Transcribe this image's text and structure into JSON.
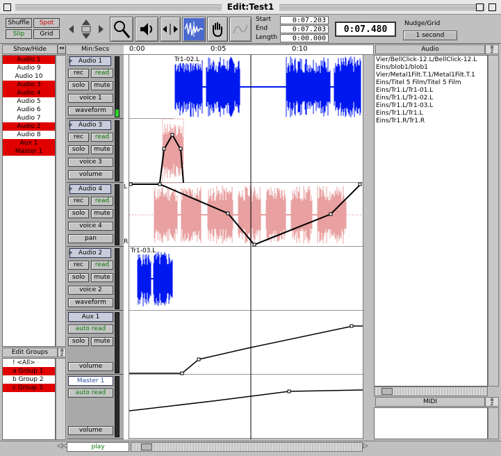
{
  "window": {
    "title": "Edit:Test1"
  },
  "modes": {
    "shuffle": "Shuffle",
    "spot": "Spot",
    "slip": "Slip",
    "grid": "Grid"
  },
  "tools": [
    "zoom-icon",
    "speaker-icon",
    "trim-icon",
    "selector-icon",
    "hand-icon",
    "pencil-icon"
  ],
  "counters": {
    "start_label": "Start",
    "start_value": "0:07.203",
    "end_label": "End",
    "end_value": "0:07.203",
    "length_label": "Length",
    "length_value": "0:00.000",
    "main_counter": "0:07.480"
  },
  "nudge": {
    "label": "Nudge/Grid",
    "value": "1 second"
  },
  "show_hide": {
    "header": "Show/Hide",
    "items": [
      {
        "label": "Audio 1",
        "selected": true
      },
      {
        "label": "Audio 9",
        "selected": false
      },
      {
        "label": "Audio 10",
        "selected": false
      },
      {
        "label": "Audio 3",
        "selected": true
      },
      {
        "label": "Audio 4",
        "selected": true
      },
      {
        "label": "Audio 5",
        "selected": false
      },
      {
        "label": "Audio 6",
        "selected": false
      },
      {
        "label": "Audio 7",
        "selected": false
      },
      {
        "label": "Audio 2",
        "selected": true
      },
      {
        "label": "Audio 8",
        "selected": false
      },
      {
        "label": "Aux 1",
        "selected": true
      },
      {
        "label": "Master 1",
        "selected": true
      }
    ]
  },
  "edit_groups": {
    "header": "Edit Groups",
    "items": [
      {
        "label": "! <All>",
        "selected": false
      },
      {
        "label": "a Group 1",
        "selected": true
      },
      {
        "label": "b Group 2",
        "selected": false
      },
      {
        "label": "c Group 3",
        "selected": true
      }
    ]
  },
  "ruler": {
    "header": "Min:Secs",
    "ticks": [
      "0:00",
      "0:05",
      "0:10"
    ]
  },
  "tracks": [
    {
      "name": "Audio 1",
      "rec": "rec",
      "read": "read",
      "solo": "solo",
      "mute": "mute",
      "voice": "voice 1",
      "view": "waveform",
      "region": "Tr1-02.L"
    },
    {
      "name": "Audio 3",
      "rec": "rec",
      "read": "read",
      "solo": "solo",
      "mute": "mute",
      "voice": "voice 3",
      "view": "volume",
      "region": ""
    },
    {
      "name": "Audio 4",
      "rec": "rec",
      "read": "read",
      "solo": "solo",
      "mute": "mute",
      "voice": "voice 4",
      "view": "pan",
      "region": "",
      "pan_left": "L",
      "pan_right": "R"
    },
    {
      "name": "Audio 2",
      "rec": "rec",
      "read": "read",
      "solo": "solo",
      "mute": "mute",
      "voice": "voice 2",
      "view": "waveform",
      "region": "Tr1-03.L"
    },
    {
      "name": "Aux 1",
      "read": "auto read",
      "solo": "solo",
      "mute": "mute",
      "view": "volume"
    },
    {
      "name": "Master 1",
      "read": "auto read",
      "view": "volume"
    }
  ],
  "audio_panel": {
    "header": "Audio",
    "items": [
      "Vier/BellClick-12.L/BellClick-12.L",
      "Eins/blob1/blob1",
      "Vier/Metal1Filt.T.1/Metal1Filt.T.1",
      "Eins/Titel 5 Film/Titel 5 Film",
      "Eins/Tr1.L/Tr1-01.L",
      "Eins/Tr1.L/Tr1-02.L",
      "Eins/Tr1.L/Tr1-03.L",
      "Eins/Tr1.L/Tr1.L",
      "Eins/Tr1.R/Tr1.R"
    ]
  },
  "midi_panel": {
    "header": "MIDI"
  },
  "footer": {
    "play": "play"
  },
  "sort_icon": "az",
  "colors": {
    "selected": "#e00000",
    "waveform": "#0018f0",
    "automation_pink": "#e8a0a0"
  }
}
